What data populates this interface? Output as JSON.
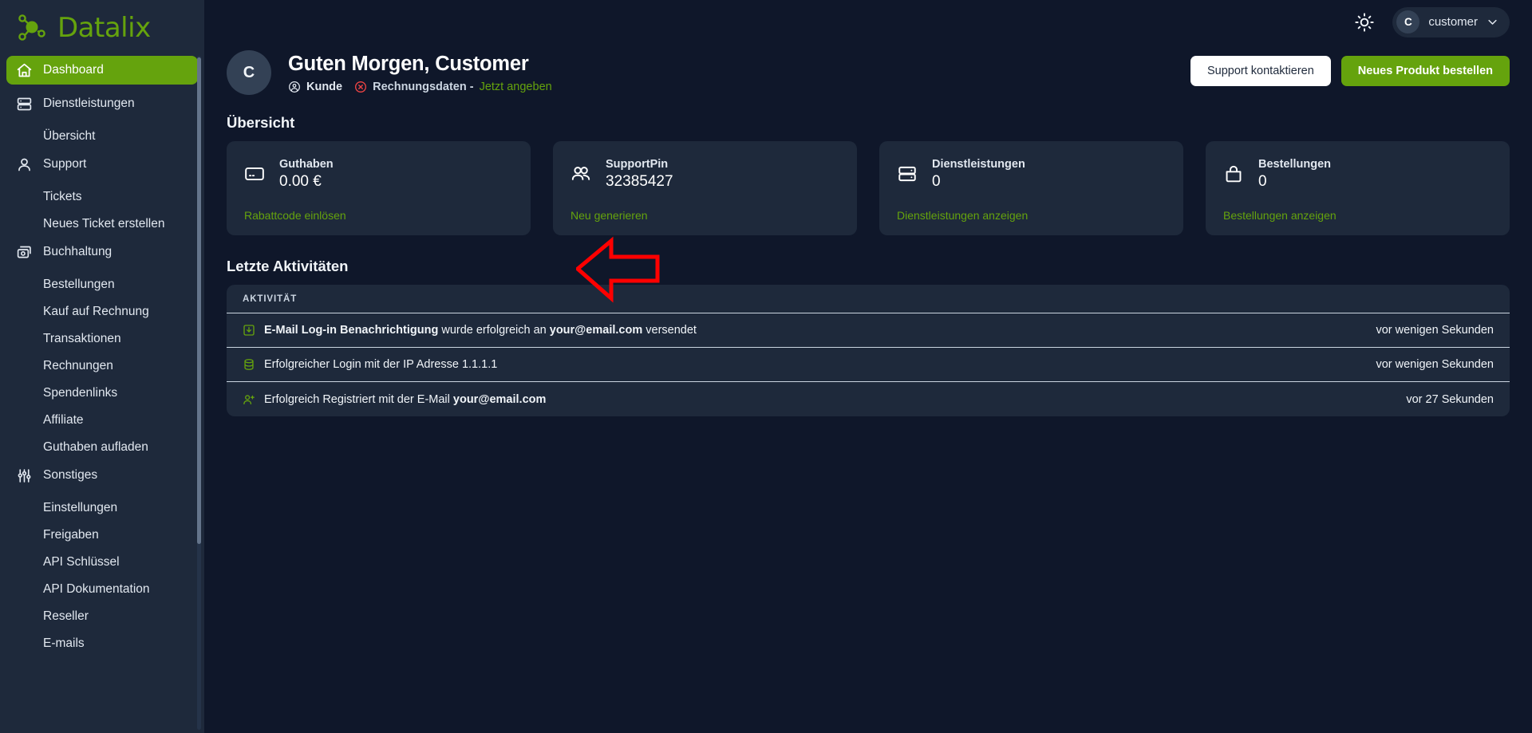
{
  "brand": {
    "name": "Datalix",
    "color": "#65a30d",
    "logo_icon": "network-nodes-icon"
  },
  "topbar": {
    "theme_toggle_icon": "sun-icon",
    "user": {
      "avatar_initial": "C",
      "name": "customer",
      "chevron_icon": "chevron-down-icon"
    }
  },
  "sidebar": {
    "items": [
      {
        "label": "Dashboard",
        "icon": "home-icon",
        "type": "group",
        "active": true
      },
      {
        "label": "Dienstleistungen",
        "icon": "server-icon",
        "type": "group",
        "active": false
      },
      {
        "label": "Übersicht",
        "icon": "",
        "type": "sub",
        "active": false
      },
      {
        "label": "Support",
        "icon": "user-icon",
        "type": "group",
        "active": false
      },
      {
        "label": "Tickets",
        "icon": "",
        "type": "sub",
        "active": false
      },
      {
        "label": "Neues Ticket erstellen",
        "icon": "",
        "type": "sub",
        "active": false
      },
      {
        "label": "Buchhaltung",
        "icon": "money-icon",
        "type": "group",
        "active": false
      },
      {
        "label": "Bestellungen",
        "icon": "",
        "type": "sub",
        "active": false
      },
      {
        "label": "Kauf auf Rechnung",
        "icon": "",
        "type": "sub",
        "active": false
      },
      {
        "label": "Transaktionen",
        "icon": "",
        "type": "sub",
        "active": false
      },
      {
        "label": "Rechnungen",
        "icon": "",
        "type": "sub",
        "active": false
      },
      {
        "label": "Spendenlinks",
        "icon": "",
        "type": "sub",
        "active": false
      },
      {
        "label": "Affiliate",
        "icon": "",
        "type": "sub",
        "active": false
      },
      {
        "label": "Guthaben aufladen",
        "icon": "",
        "type": "sub",
        "active": false
      },
      {
        "label": "Sonstiges",
        "icon": "sliders-icon",
        "type": "group",
        "active": false
      },
      {
        "label": "Einstellungen",
        "icon": "",
        "type": "sub",
        "active": false
      },
      {
        "label": "Freigaben",
        "icon": "",
        "type": "sub",
        "active": false
      },
      {
        "label": "API Schlüssel",
        "icon": "",
        "type": "sub",
        "active": false
      },
      {
        "label": "API Dokumentation",
        "icon": "",
        "type": "sub",
        "active": false
      },
      {
        "label": "Reseller",
        "icon": "",
        "type": "sub",
        "active": false
      },
      {
        "label": "E-mails",
        "icon": "",
        "type": "sub",
        "active": false
      }
    ]
  },
  "greeting": {
    "avatar_initial": "C",
    "title": "Guten Morgen, Customer",
    "role_icon": "user-circle-icon",
    "role": "Kunde",
    "warning_icon": "alert-circle-icon",
    "billing_label": "Rechnungsdaten -",
    "billing_action": "Jetzt angeben",
    "buttons": {
      "support": "Support kontaktieren",
      "order": "Neues Produkt bestellen"
    }
  },
  "overview": {
    "title": "Übersicht",
    "cards": [
      {
        "icon": "credit-card-icon",
        "label": "Guthaben",
        "value": "0.00 €",
        "link": "Rabattcode einlösen"
      },
      {
        "icon": "users-icon",
        "label": "SupportPin",
        "value": "32385427",
        "link": "Neu generieren"
      },
      {
        "icon": "server-icon",
        "label": "Dienstleistungen",
        "value": "0",
        "link": "Dienstleistungen anzeigen"
      },
      {
        "icon": "shopping-bag-icon",
        "label": "Bestellungen",
        "value": "0",
        "link": "Bestellungen anzeigen"
      }
    ]
  },
  "activities": {
    "title": "Letzte Aktivitäten",
    "column_header": "AKTIVITÄT",
    "rows": [
      {
        "icon": "inbox-download-icon",
        "text_bold_1": "E-Mail Log-in Benachrichtigung",
        "text_mid": " wurde erfolgreich an ",
        "text_bold_2": "your@email.com",
        "text_end": " versendet",
        "time": "vor wenigen Sekunden"
      },
      {
        "icon": "database-icon",
        "text_bold_1": "",
        "text_mid": "Erfolgreicher Login mit der IP Adresse 1.1.1.1",
        "text_bold_2": "",
        "text_end": "",
        "time": "vor wenigen Sekunden"
      },
      {
        "icon": "user-plus-icon",
        "text_bold_1": "",
        "text_mid": "Erfolgreich Registriert mit der E-Mail ",
        "text_bold_2": "your@email.com",
        "text_end": "",
        "time": "vor 27 Sekunden"
      }
    ]
  },
  "annotation": {
    "shape": "left-arrow",
    "color": "#ff0000",
    "points_at": "Rabattcode einlösen"
  },
  "colors": {
    "page_bg": "#0f172a",
    "panel_bg": "#1e293b",
    "accent": "#65a30d",
    "text": "#f1f5f9",
    "muted": "#cbd5e1",
    "danger": "#ef4444"
  }
}
